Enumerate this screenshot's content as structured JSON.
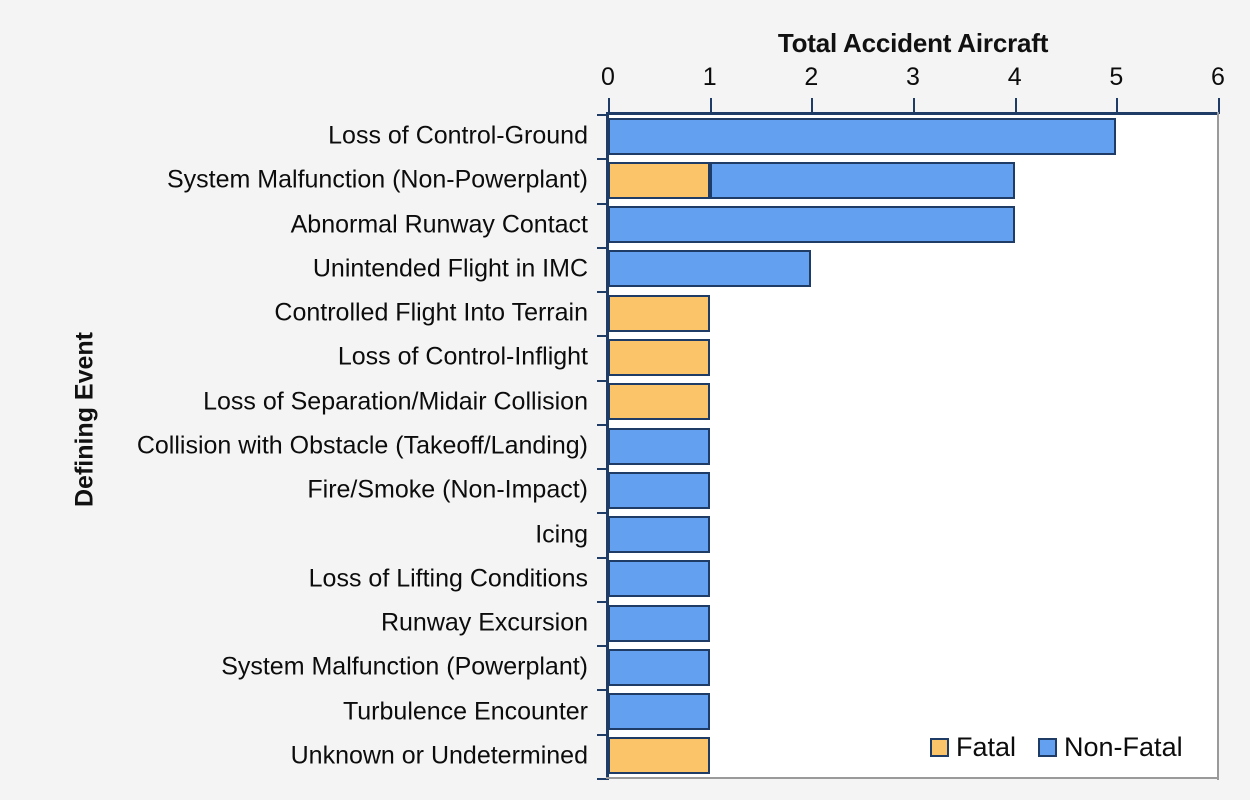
{
  "chart_data": {
    "type": "bar",
    "orientation": "horizontal",
    "stacked": true,
    "title": "",
    "xlabel": "Total Accident Aircraft",
    "ylabel": "Defining Event",
    "xlim": [
      0,
      6
    ],
    "xticks": [
      0,
      1,
      2,
      3,
      4,
      5,
      6
    ],
    "xtick_labels": [
      "0",
      "1",
      "2",
      "3",
      "4",
      "5",
      "6"
    ],
    "grid": false,
    "legend_position": "bottom-right",
    "categories": [
      "Loss of Control-Ground",
      "System Malfunction (Non-Powerplant)",
      "Abnormal Runway Contact",
      "Unintended Flight in IMC",
      "Controlled Flight Into Terrain",
      "Loss of Control-Inflight",
      "Loss of Separation/Midair Collision",
      "Collision with Obstacle (Takeoff/Landing)",
      "Fire/Smoke (Non-Impact)",
      "Icing",
      "Loss of Lifting Conditions",
      "Runway Excursion",
      "System Malfunction (Powerplant)",
      "Turbulence Encounter",
      "Unknown or Undetermined"
    ],
    "series": [
      {
        "name": "Fatal",
        "color": "#fbc468",
        "values": [
          0,
          1,
          0,
          0,
          1,
          1,
          1,
          0,
          0,
          0,
          0,
          0,
          0,
          0,
          1
        ]
      },
      {
        "name": "Non-Fatal",
        "color": "#63a0f0",
        "values": [
          5,
          3,
          4,
          2,
          0,
          0,
          0,
          1,
          1,
          1,
          1,
          1,
          1,
          1,
          0
        ]
      }
    ],
    "totals": [
      5,
      4,
      4,
      2,
      1,
      1,
      1,
      1,
      1,
      1,
      1,
      1,
      1,
      1,
      1
    ]
  },
  "legend": {
    "items": [
      {
        "label": "Fatal",
        "color": "#fbc468"
      },
      {
        "label": "Non-Fatal",
        "color": "#63a0f0"
      }
    ]
  },
  "colors": {
    "fatal": "#fbc468",
    "non_fatal": "#63a0f0",
    "bar_border": "#1f3c66",
    "background": "#f4f4f4",
    "plot_background": "#ffffff",
    "text": "#0c0c0c"
  }
}
